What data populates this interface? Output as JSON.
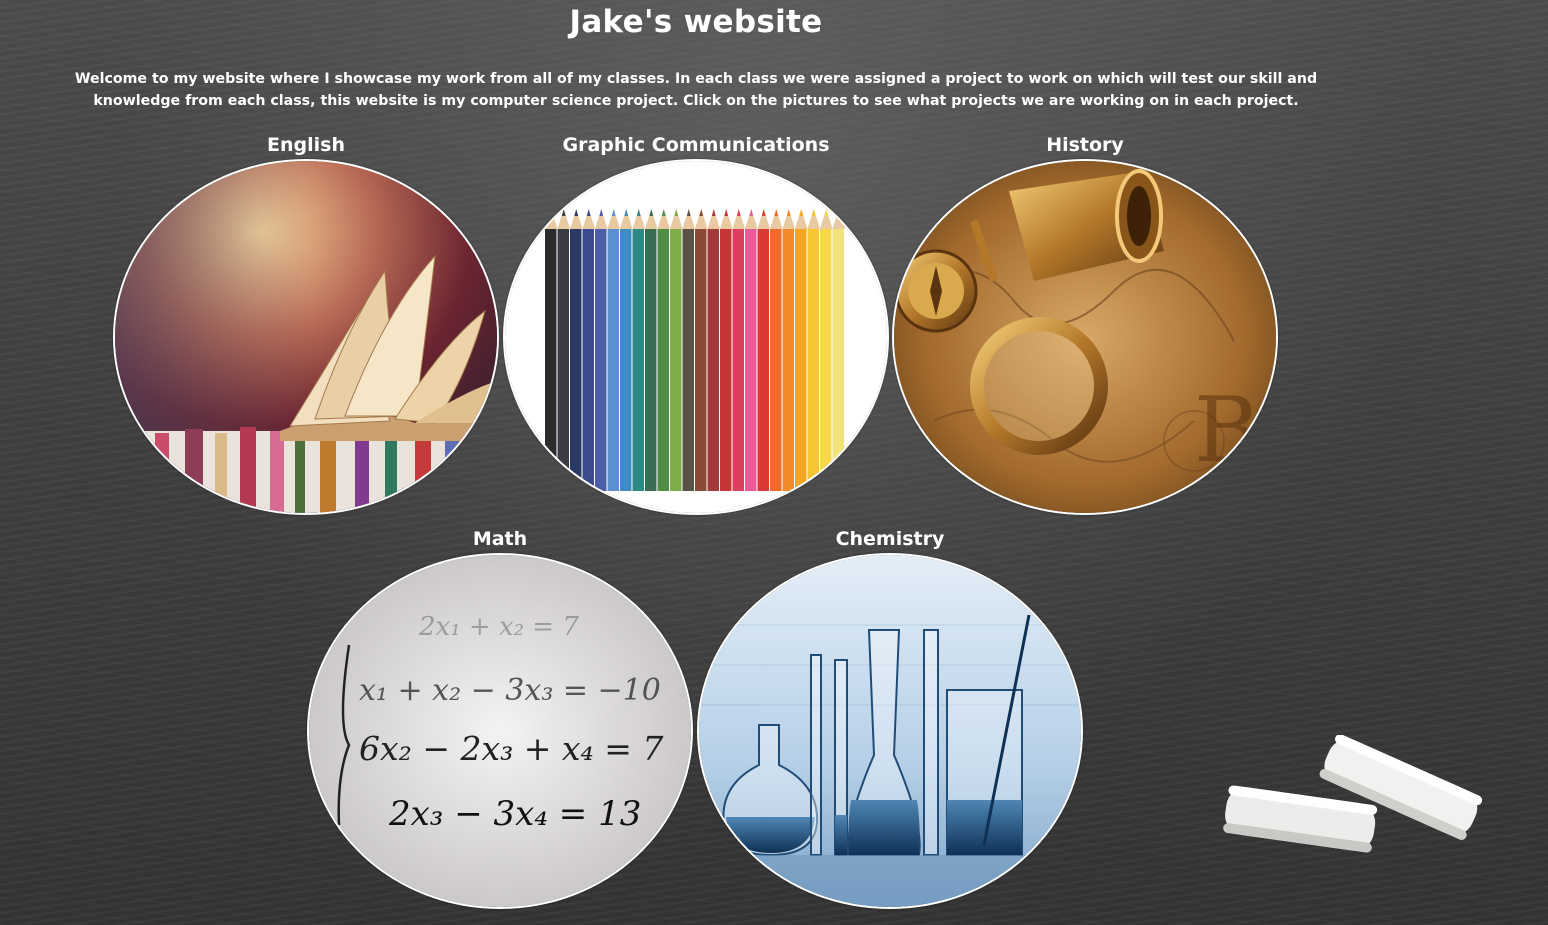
{
  "page": {
    "title": "Jake's website",
    "intro": "Welcome to my website where I showcase my work from all of my classes. In each class we were assigned a project to work on which will test our skill and knowledge from each class, this website is my computer science project. Click on the pictures to see what projects we are working on in each project."
  },
  "classes": [
    {
      "label": "English",
      "image": "books-image"
    },
    {
      "label": "Graphic Communications",
      "image": "colored-pencils-image"
    },
    {
      "label": "History",
      "image": "compass-map-image"
    },
    {
      "label": "Math",
      "image": "equations-image"
    },
    {
      "label": "Chemistry",
      "image": "lab-glassware-image"
    }
  ],
  "math_image_text": {
    "eq1": "2x₁ + x₂ = 7",
    "eq2": "x₁ + x₂ − 3x₃ = −10",
    "eq3": "6x₂ − 2x₃ + x₄ = 7",
    "eq4": "2x₃ − 3x₄ = 13"
  },
  "colors": {
    "chalkboard": "#3f3f3f",
    "text": "#ffffff",
    "circle_border": "#ffffff"
  }
}
